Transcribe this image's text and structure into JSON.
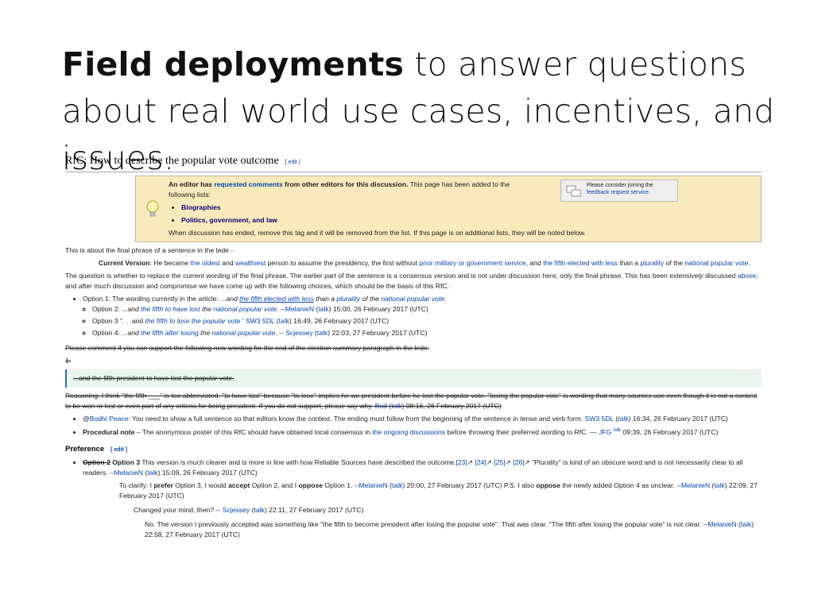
{
  "slide": {
    "title_bold": "Field deployments",
    "title_rest": " to answer questions about real world use cases, incentives, and issues."
  },
  "section": {
    "title": "RfC: How to describe the popular vote outcome",
    "edit": "[ edit ]"
  },
  "rfc": {
    "line1_a": "An editor has ",
    "line1_link": "requested comments",
    "line1_b": " from other editors for this discussion.",
    "line1_c": " This page has been added to the following lists:",
    "list": [
      "Biographies",
      "Politics, government, and law"
    ],
    "footer": "When discussion has ended, remove this tag and it will be removed from the list. If this page is on additional lists, they will be noted below.",
    "feedback_a": "Please consider joining the ",
    "feedback_link": "feedback request service",
    "feedback_b": "."
  },
  "intro": "This is about the final phrase of a sentence in the lede -",
  "current_version": {
    "label": "Current Version",
    "t1": ": He became ",
    "l1": "the oldest",
    "t2": " and ",
    "l2": "wealthiest",
    "t3": " person to assume the presidency, the first without ",
    "l3": "prior military or government service",
    "t4": ", and ",
    "l4": "the fifth elected with less",
    "t5": " than a ",
    "l5": "plurality",
    "t6": " of the ",
    "l6": "national popular vote",
    "t7": "."
  },
  "question": {
    "t1": "The question is whether to replace the current wording of the final phrase. The earlier part of the sentence is a consensus version and is not under discussion here, only the final phrase. This has been ",
    "em": "extensively",
    "t2": " discussed ",
    "l1": "above",
    "t3": ", and after much discussion and compromise we have come up with the following choices, which should be the basis of this RfC."
  },
  "options": {
    "o1_a": "Option 1: The wording currently in the article: ",
    "o1_b": "...and ",
    "o1_l1": "the fifth elected with less",
    "o1_c": " than a ",
    "o1_l2": "plurality",
    "o1_d": " of the ",
    "o1_l3": "national popular vote",
    "o1_e": ".",
    "o2_a": "Option 2: ",
    "o2_b": "...and ",
    "o2_l1": "the fifth to have lost",
    "o2_c": " the ",
    "o2_l2": "national popular vote",
    "o2_d": ". --",
    "o2_u": "MelanieN",
    "o2_t": "talk",
    "o2_e": " 15:00, 26 February 2017 (UTC)",
    "o3_a": "Option 3 \". . .and ",
    "o3_l1": "the fifth to lose the popular vote",
    "o3_b": " ' ",
    "o3_u": "SW3 5DL",
    "o3_t": "talk",
    "o3_e": " 16:49, 26 February 2017 (UTC)",
    "o4_a": "Option 4: ",
    "o4_b": "...and ",
    "o4_l1": "the fifth after losing",
    "o4_c": " the ",
    "o4_l2": "national popular vote",
    "o4_d": ". -- ",
    "o4_u": "Scjessey",
    "o4_t": "talk",
    "o4_e": " 22:03, 27 February 2017 (UTC)"
  },
  "struck": {
    "please": "Please comment if you can support the following new wording for the end of the election summary paragraph in the lede.",
    "num": "1.",
    "quote": "...and the fifth president to have lost the popular vote.",
    "reasoning_a": "Reasoning: I think \"the fifth ___\" is too abbreviated. \"to have lost\" because \"to lose\" implies he we president before he lost the popular vote. \"losing the popular vote\" is wording that many sources use even though it is not a contest to be won or lost or even part of any criteria for being president. If you do not support, please say why. ",
    "reasoning_u": "Bod",
    "reasoning_t": "talk",
    "reasoning_e": " 08:16, 26 February 2017 (UTC)"
  },
  "notes": {
    "n1_a": "@",
    "n1_u": "Bodhi Peace",
    "n1_b": ": You need to show a full sentence so that editors know the context. The ending must follow from the beginning of the sentence in tense and verb form. ",
    "n1_u2": "SW3 5DL",
    "n1_t": "talk",
    "n1_e": " 16:34, 26 February 2017 (UTC)",
    "n2_label": "Procedural note",
    "n2_a": " – The anonymous poster of this RfC should have obtained local consensus in ",
    "n2_l": "the ongoing discussions",
    "n2_b": " before throwing their preferred wording to RfC. — ",
    "n2_u": "JFG",
    "n2_t": "talk",
    "n2_e": " 09:39, 26 February 2017 (UTC)"
  },
  "preference": {
    "title": "Preference",
    "edit": "[ edit ]",
    "p1_s": "Option 2",
    "p1_b": "Option 3",
    "p1_a": " This version is much clearer and is more in line with how Reliable Sources have described the outcome.",
    "refs": [
      "[23]",
      "[24]",
      "[25]",
      "[26]"
    ],
    "p1_c": " \"Plurality\" is kind of an obscure word and is not necessarily clear to all readers. --",
    "p1_u": "MelanieN",
    "p1_t": "talk",
    "p1_e": " 15:09, 26 February 2017 (UTC)",
    "r1_a": "To clarify: I ",
    "r1_b1": "prefer",
    "r1_c": " Option 3, I would ",
    "r1_b2": "accept",
    "r1_d": " Option 2, and I ",
    "r1_b3": "oppose",
    "r1_e": " Option 1. --",
    "r1_u": "MelanieN",
    "r1_t": "talk",
    "r1_f": " 20:00, 27 February 2017 (UTC) P.S. I also ",
    "r1_b4": "oppose",
    "r1_g": " the newly added Option 4 as unclear. --",
    "r1_u2": "MelanieN",
    "r1_t2": "talk",
    "r1_h": " 22:09, 27 February 2017 (UTC)",
    "r2_a": "Changed your mind, then? -- ",
    "r2_u": "Scjessey",
    "r2_t": "talk",
    "r2_e": " 22:11, 27 February 2017 (UTC)",
    "r3_a": "No. The version I previously accepted was something like \"the fifth to become president after losing the popular vote\". That was clear. \"The fifth after losing the popular vote\" is not clear. --",
    "r3_u": "MelanieN",
    "r3_t": "talk",
    "r3_e": " 22:58, 27 February 2017 (UTC)"
  }
}
